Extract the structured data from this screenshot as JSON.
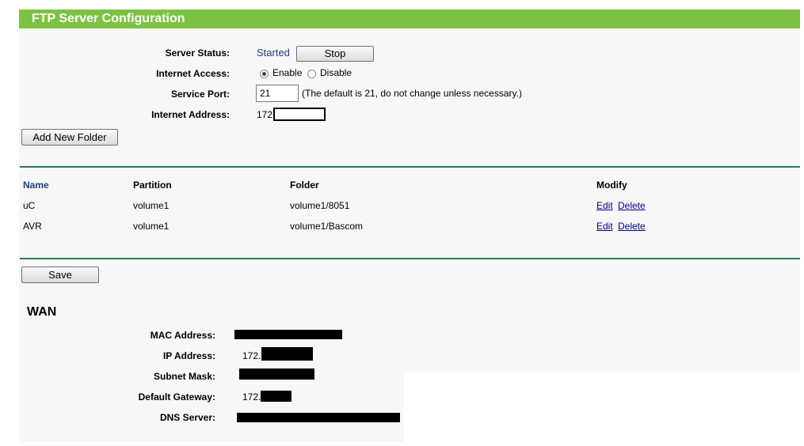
{
  "title": "FTP Server Configuration",
  "server": {
    "status_label": "Server Status:",
    "status_value": "Started",
    "stop_button": "Stop",
    "access_label": "Internet Access:",
    "enable_label": "Enable",
    "disable_label": "Disable",
    "access_selected": "Enable",
    "port_label": "Service Port:",
    "port_value": "21",
    "port_hint": "(The default is 21, do not change unless necessary.)",
    "address_label": "Internet Address:",
    "address_prefix": "172."
  },
  "add_folder_button": "Add New Folder",
  "table": {
    "headers": {
      "name": "Name",
      "partition": "Partition",
      "folder": "Folder",
      "modify": "Modify"
    },
    "rows": [
      {
        "name": "uC",
        "partition": "volume1",
        "folder": "volume1/8051",
        "edit": "Edit",
        "delete": "Delete"
      },
      {
        "name": "AVR",
        "partition": "volume1",
        "folder": "volume1/Bascom",
        "edit": "Edit",
        "delete": "Delete"
      }
    ]
  },
  "save_button": "Save",
  "wan": {
    "heading": "WAN",
    "mac_label": "MAC Address:",
    "ip_label": "IP Address:",
    "ip_prefix": "172.",
    "subnet_label": "Subnet Mask:",
    "gateway_label": "Default Gateway:",
    "gateway_prefix": "172.",
    "dns_label": "DNS Server:"
  },
  "colors": {
    "title_bar": "#7cc242",
    "rule": "#2e7d4f",
    "panel": "#f7f7f7",
    "status_text": "#1c3f73",
    "link": "#00007f"
  }
}
